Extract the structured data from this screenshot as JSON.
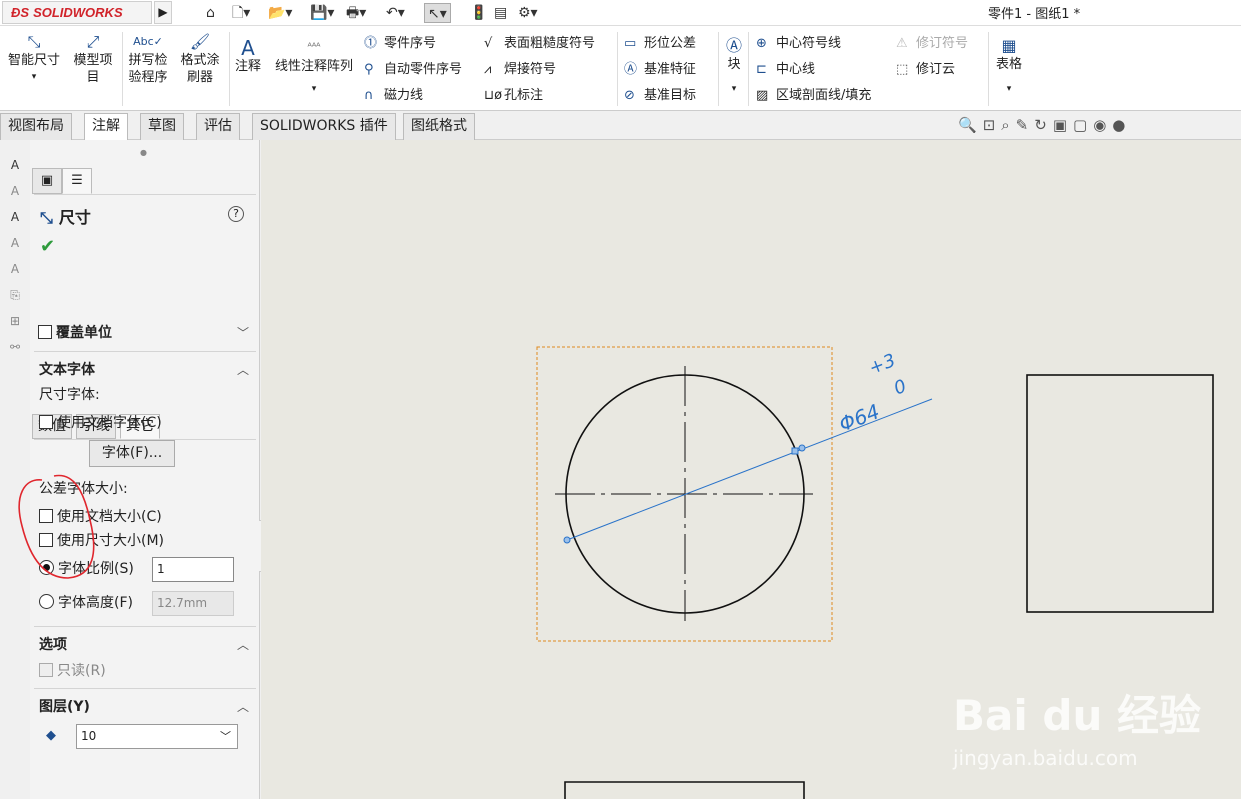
{
  "app": {
    "logo": "SOLIDWORKS",
    "doc_title": "零件1 - 图纸1 *"
  },
  "ribbon": {
    "smart_dim": "智能尺寸",
    "model_items": "模型项目",
    "spell": "拼写检验程序",
    "format_painter": "格式涂刷器",
    "note": "注释",
    "linear_pattern": "线性注释阵列",
    "balloon": "零件序号",
    "auto_balloon": "自动零件序号",
    "magnetic_line": "磁力线",
    "surface_finish": "表面粗糙度符号",
    "weld_symbol": "焊接符号",
    "hole_callout": "孔标注",
    "gtol": "形位公差",
    "datum_feature": "基准特征",
    "datum_target": "基准目标",
    "blocks": "块",
    "center_mark": "中心符号线",
    "centerline": "中心线",
    "area_hatch": "区域剖面线/填充",
    "revision_symbol": "修订符号",
    "revision_cloud": "修订云",
    "tables": "表格"
  },
  "tabs": [
    "视图布局",
    "注解",
    "草图",
    "评估",
    "SOLIDWORKS 插件",
    "图纸格式"
  ],
  "panel": {
    "title": "尺寸",
    "help": "?",
    "subtabs": [
      "数值",
      "引线",
      "其它"
    ],
    "override_units": "覆盖单位",
    "text_fonts": "文本字体",
    "dim_font": "尺寸字体:",
    "use_doc_font": "使用文档字体(C)",
    "font_button": "字体(F)...",
    "tol_font_size": "公差字体大小:",
    "use_doc_size": "使用文档大小(C)",
    "use_dim_size": "使用尺寸大小(M)",
    "font_scale": "字体比例(S)",
    "font_scale_value": "1",
    "font_height": "字体高度(F)",
    "font_height_value": "12.7mm",
    "options": "选项",
    "read_only": "只读(R)",
    "layer": "图层(Y)",
    "layer_value": "10"
  },
  "drawing": {
    "dim_text": "Φ64",
    "tol_upper": "+3",
    "tol_lower": "0",
    "watermark": "Bai du 经验",
    "watermark_url": "jingyan.baidu.com"
  },
  "colors": {
    "annotation": "#2a73c9",
    "selection_box": "#e08a1e",
    "annotation_red": "#e0262d"
  }
}
